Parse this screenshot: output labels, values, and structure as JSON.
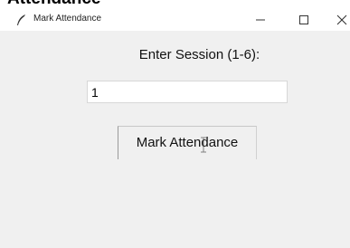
{
  "page_heading": "Attendance",
  "window": {
    "title": "Mark Attendance",
    "icon": "feather-icon",
    "controls": {
      "minimize": "minimize-icon",
      "maximize": "maximize-icon",
      "close": "close-icon"
    }
  },
  "form": {
    "prompt_label": "Enter Session (1-6):",
    "session_value": "1",
    "submit_label": "Mark Attendance"
  },
  "cursor": "text-cursor-icon"
}
